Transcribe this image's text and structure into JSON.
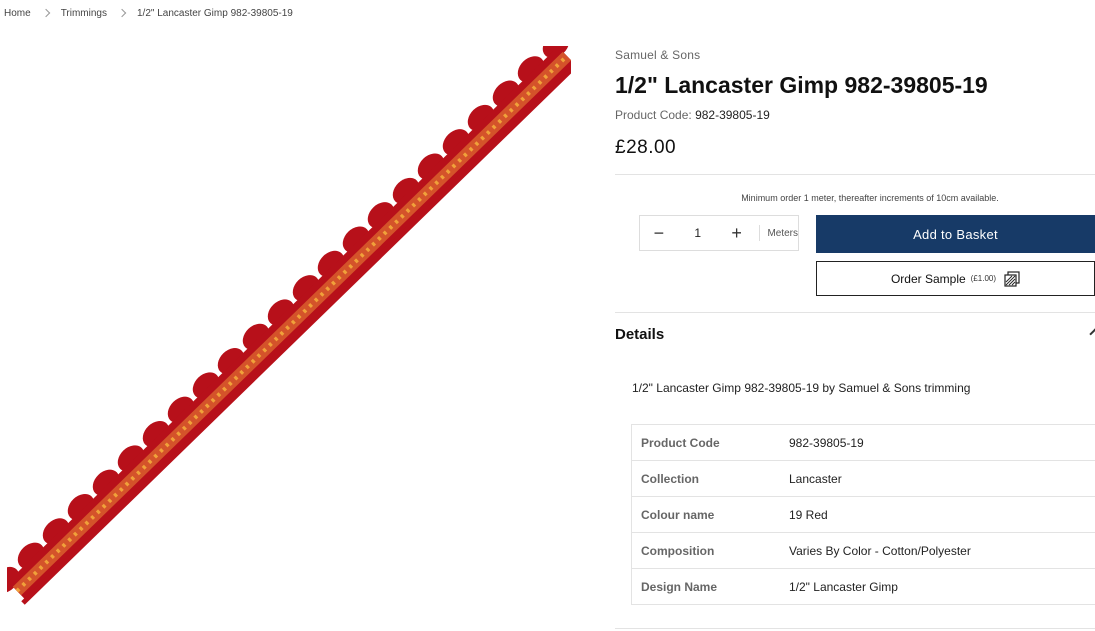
{
  "breadcrumb": {
    "home": "Home",
    "category": "Trimmings",
    "current": "1/2\" Lancaster Gimp 982-39805-19"
  },
  "product": {
    "brand": "Samuel & Sons",
    "title": "1/2\" Lancaster Gimp 982-39805-19",
    "code_label": "Product Code:",
    "code_value": "982-39805-19",
    "price": "£28.00",
    "min_order": "Minimum order 1 meter, thereafter increments of 10cm available.",
    "image_colors": {
      "trim": "#b7101a",
      "core": "#d4532a",
      "dots": "#f0a13a"
    }
  },
  "quantity": {
    "minus": "−",
    "value": "1",
    "plus": "+",
    "unit": "Meters"
  },
  "buttons": {
    "add_to_basket": "Add to Basket",
    "order_sample": "Order Sample",
    "sample_price": "(£1.00)",
    "basket_color": "#173a67"
  },
  "details": {
    "heading": "Details",
    "description": "1/2\" Lancaster Gimp 982-39805-19 by Samuel & Sons trimming",
    "specs": [
      {
        "label": "Product Code",
        "value": "982-39805-19"
      },
      {
        "label": "Collection",
        "value": "Lancaster"
      },
      {
        "label": "Colour name",
        "value": "19 Red"
      },
      {
        "label": "Composition",
        "value": "Varies By Color - Cotton/Polyester"
      },
      {
        "label": "Design Name",
        "value": "1/2\" Lancaster Gimp"
      }
    ]
  }
}
